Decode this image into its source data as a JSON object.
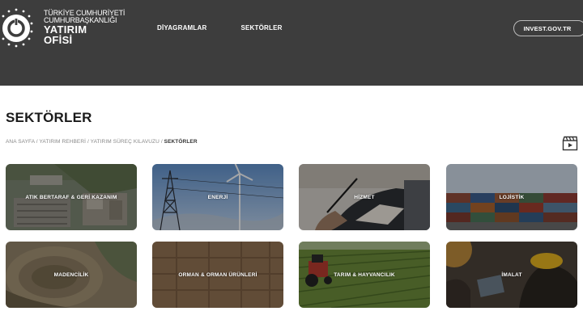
{
  "header": {
    "logo": {
      "line1": "TÜRKİYE CUMHURİYETİ",
      "line2": "CUMHURBAŞKANLIĞI",
      "line3": "YATIRIM",
      "line4": "OFİSİ"
    },
    "nav": [
      {
        "label": "DİYAGRAMLAR"
      },
      {
        "label": "SEKTÖRLER"
      }
    ],
    "invest_link": "INVEST.GOV.TR"
  },
  "page": {
    "title": "SEKTÖRLER",
    "breadcrumb": [
      {
        "label": "ANA SAYFA"
      },
      {
        "label": "YATIRIM REHBERİ"
      },
      {
        "label": "YATIRIM SÜREÇ KILAVUZU"
      },
      {
        "label": "SEKTÖRLER"
      }
    ],
    "video_icon": "clapperboard-icon"
  },
  "sectors": [
    {
      "label": "ATIK BERTARAF & GERİ KAZANIM"
    },
    {
      "label": "ENERJİ"
    },
    {
      "label": "HİZMET"
    },
    {
      "label": "LOJİSTİK"
    },
    {
      "label": "MADENCİLİK"
    },
    {
      "label": "ORMAN & ORMAN ÜRÜNLERİ"
    },
    {
      "label": "TARIM & HAYVANCILIK"
    },
    {
      "label": "İMALAT"
    }
  ],
  "colors": {
    "header_bg": "#3d3d3d",
    "text_dark": "#1a1a1a"
  }
}
